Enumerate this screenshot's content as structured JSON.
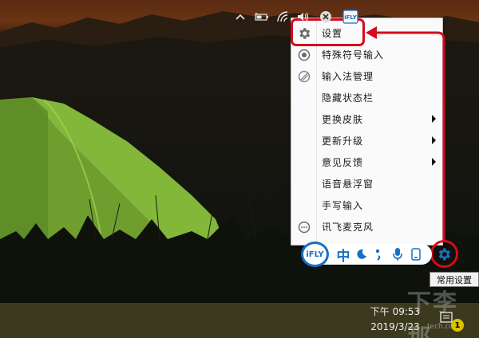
{
  "menu": {
    "items": [
      {
        "label": "设置",
        "icon": "gear-icon",
        "has_submenu": false
      },
      {
        "label": "特殊符号输入",
        "icon": "radio-dot-icon",
        "has_submenu": false
      },
      {
        "label": "输入法管理",
        "icon": "manage-icon",
        "has_submenu": false
      },
      {
        "label": "隐藏状态栏",
        "icon": "",
        "has_submenu": false
      },
      {
        "label": "更换皮肤",
        "icon": "",
        "has_submenu": true
      },
      {
        "label": "更新升级",
        "icon": "",
        "has_submenu": true
      },
      {
        "label": "意见反馈",
        "icon": "",
        "has_submenu": true
      },
      {
        "label": "语音悬浮窗",
        "icon": "",
        "has_submenu": false
      },
      {
        "label": "手写输入",
        "icon": "",
        "has_submenu": false
      },
      {
        "label": "讯飞麦克风",
        "icon": "ellipsis-circle-icon",
        "has_submenu": false
      }
    ]
  },
  "ime_bar": {
    "logo": "iFLY",
    "mode": "中",
    "buttons": [
      "moon-icon",
      "punctuation-icon",
      "microphone-icon",
      "keyboard-icon",
      "gear-icon"
    ]
  },
  "tooltip": "常用设置",
  "taskbar": {
    "time": "下午 09:53",
    "date": "2019/3/23",
    "notification_count": "1",
    "tray_icons": [
      "chevron-up-icon",
      "battery-icon",
      "wifi-icon",
      "volume-icon",
      "close-circle-icon",
      "ifly-tray-icon"
    ]
  },
  "watermark": {
    "text": "下李那",
    "sub": "tech.com"
  },
  "colors": {
    "accent": "#1571c6",
    "annotation": "#d40b1e",
    "taskbar": "#3b3a1f",
    "tent": "#7db33a"
  }
}
